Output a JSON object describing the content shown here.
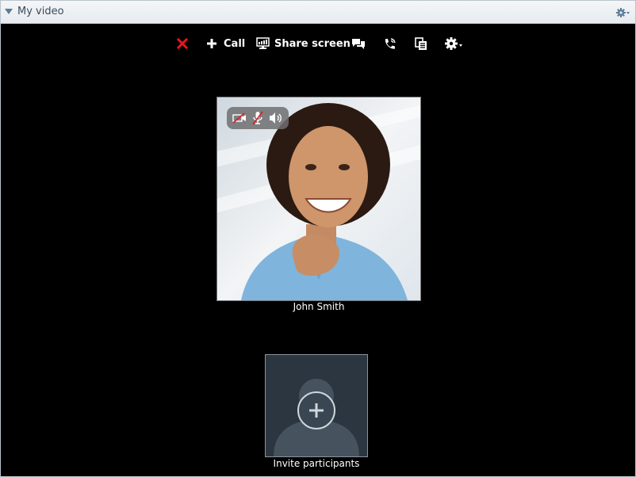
{
  "window": {
    "title": "My video"
  },
  "toolbar": {
    "end_call_icon": "close-x-icon",
    "call_label": "Call",
    "share_screen_label": "Share screen",
    "chat_icon": "chat-bubbles-icon",
    "phone_icon": "phone-icon",
    "documents_icon": "documents-icon",
    "settings_icon": "gear-dropdown-icon"
  },
  "participant": {
    "name": "John Smith",
    "controls": [
      "camera-off-icon",
      "mic-off-icon",
      "speaker-icon"
    ]
  },
  "invite": {
    "label": "Invite participants"
  },
  "colors": {
    "end_call": "#e0191f",
    "background": "#000000",
    "title_bar": "#eef1f4"
  }
}
